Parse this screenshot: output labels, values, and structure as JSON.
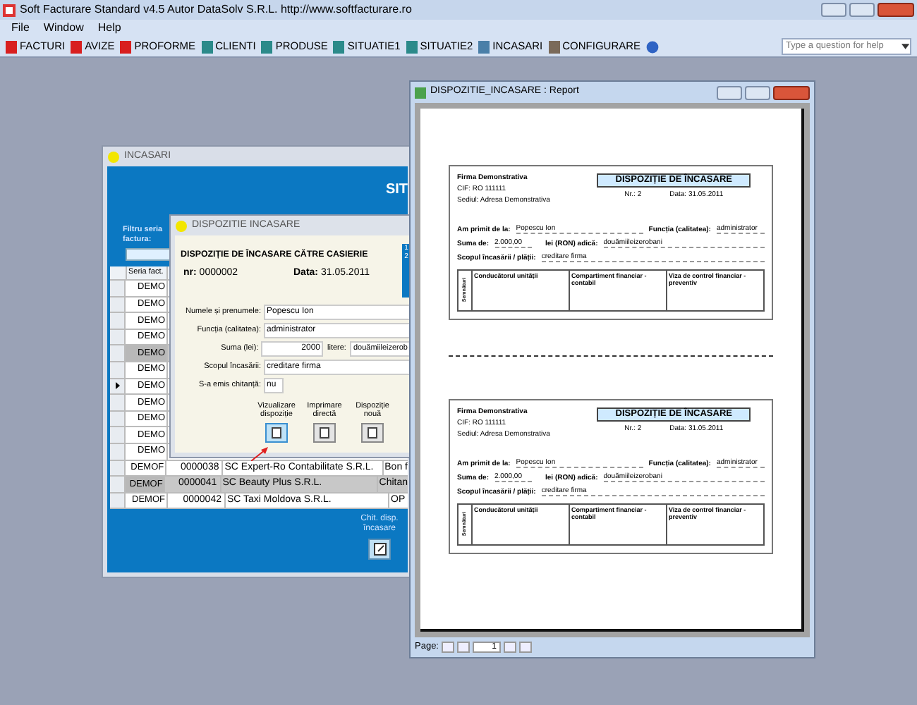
{
  "app": {
    "title": "Soft Facturare Standard v4.5 Autor DataSolv S.R.L. http://www.softfacturare.ro",
    "menu": [
      "File",
      "Window",
      "Help"
    ],
    "toolbar": [
      {
        "label": "FACTURI",
        "color": "#d81f1f"
      },
      {
        "label": "AVIZE",
        "color": "#d81f1f"
      },
      {
        "label": "PROFORME",
        "color": "#d81f1f"
      },
      {
        "label": "CLIENTI",
        "color": "#2b8a8a"
      },
      {
        "label": "PRODUSE",
        "color": "#2b8a8a"
      },
      {
        "label": "SITUATIE1",
        "color": "#2b8a8a"
      },
      {
        "label": "SITUATIE2",
        "color": "#2b8a8a"
      },
      {
        "label": "INCASARI",
        "color": "#4a7fa8"
      },
      {
        "label": "CONFIGURARE",
        "color": "#7a6a5a"
      }
    ],
    "help_box": {
      "placeholder": "Type a question for help"
    }
  },
  "incasari": {
    "title": "INCASARI",
    "header": "SIT",
    "filter_label": "Filtru seria factura:",
    "column": "Seria fact.",
    "rows": [
      {
        "seria": "DEMO",
        "selected": false,
        "current": false
      },
      {
        "seria": "DEMO",
        "selected": false,
        "current": false
      },
      {
        "seria": "DEMO",
        "selected": false,
        "current": false
      },
      {
        "seria": "DEMO",
        "selected": false,
        "current": false
      },
      {
        "seria": "DEMO",
        "selected": true,
        "current": false
      },
      {
        "seria": "DEMO",
        "selected": false,
        "current": false
      },
      {
        "seria": "DEMO",
        "selected": false,
        "current": true
      },
      {
        "seria": "DEMO",
        "selected": false,
        "current": false
      },
      {
        "seria": "DEMO",
        "selected": false,
        "current": false
      },
      {
        "seria": "DEMO",
        "selected": false,
        "current": false
      },
      {
        "seria": "DEMO",
        "selected": false,
        "current": false
      },
      {
        "seria": "DEMOF",
        "number": "0000038",
        "client": "SC Expert-Ro Contabilitate S.R.L.",
        "payment": "Bon f",
        "selected": false,
        "current": false
      },
      {
        "seria": "DEMOF",
        "number": "0000041",
        "client": "SC Beauty Plus S.R.L.",
        "payment": "Chitan",
        "selected": true,
        "current": false
      },
      {
        "seria": "DEMOF",
        "number": "0000042",
        "client": "SC Taxi Moldova S.R.L.",
        "payment": "OP",
        "selected": false,
        "current": false
      }
    ],
    "bottom_button": "Chit. disp. încasare"
  },
  "dialog": {
    "title": "DISPOZITIE INCASARE",
    "heading": "DISPOZIȚIE DE ÎNCASARE CĂTRE CASIERIE",
    "nr_label": "nr:",
    "nr": "0000002",
    "date_label": "Data:",
    "date": "31.05.2011",
    "side_numbers": [
      "1",
      "2"
    ],
    "fields": [
      {
        "label": "Numele și prenumele:",
        "value": "Popescu Ion",
        "kind": "text"
      },
      {
        "label": "Funcția (calitatea):",
        "value": "administrator",
        "kind": "text"
      },
      {
        "label": "Suma (lei):",
        "value": "2000",
        "kind": "amount",
        "extra_label": "litere:",
        "extra_value": "douămiileizerob"
      },
      {
        "label": "Scopul încasării:",
        "value": "creditare firma",
        "kind": "text"
      },
      {
        "label": "S-a emis chitanță:",
        "value": "nu",
        "kind": "short"
      }
    ],
    "buttons": [
      {
        "label": "Vizualizare dispoziție",
        "selected": true
      },
      {
        "label": "Imprimare directă",
        "selected": false
      },
      {
        "label": "Dispoziție nouă",
        "selected": false
      }
    ]
  },
  "report": {
    "title": "DISPOZITIE_INCASARE : Report",
    "copies": [
      {
        "company": "Firma Demonstrativa",
        "cif": "CIF: RO 111111",
        "address": "Sediul: Adresa Demonstrativa",
        "heading": "DISPOZIȚIE DE ÎNCASARE",
        "nr": "Nr.: 2",
        "date": "Data: 31.05.2011",
        "from_label": "Am primit de la:",
        "from": "Popescu Ion",
        "role_label": "Funcția (calitatea):",
        "role": "administrator",
        "sum_label": "Suma de:",
        "sum": "2.000,00",
        "words_label": "lei (RON) adică:",
        "words": "douămiileizerobani",
        "purpose_label": "Scopul încasării / plății:",
        "purpose": "creditare firma",
        "sign_label": "Semnături",
        "columns": [
          "Conducătorul unității",
          "Compartiment financiar - contabil",
          "Viza de control financiar - preventiv"
        ]
      },
      {
        "company": "Firma Demonstrativa",
        "cif": "CIF: RO 111111",
        "address": "Sediul: Adresa Demonstrativa",
        "heading": "DISPOZIȚIE DE ÎNCASARE",
        "nr": "Nr.: 2",
        "date": "Data: 31.05.2011",
        "from_label": "Am primit de la:",
        "from": "Popescu Ion",
        "role_label": "Funcția (calitatea):",
        "role": "administrator",
        "sum_label": "Suma de:",
        "sum": "2.000,00",
        "words_label": "lei (RON) adică:",
        "words": "douămiileizerobani",
        "purpose_label": "Scopul încasării / plății:",
        "purpose": "creditare firma",
        "sign_label": "Semnături",
        "columns": [
          "Conducătorul unității",
          "Compartiment financiar - contabil",
          "Viza de control financiar - preventiv"
        ]
      }
    ],
    "pager": {
      "label": "Page:",
      "value": "1"
    }
  }
}
